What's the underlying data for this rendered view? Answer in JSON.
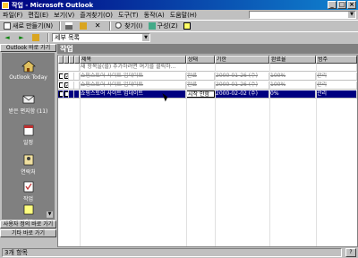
{
  "window": {
    "title": "작업 - Microsoft Outlook"
  },
  "menu": [
    "파일(F)",
    "편집(E)",
    "보기(V)",
    "즐겨찾기(O)",
    "도구(T)",
    "동작(A)",
    "도움말(H)"
  ],
  "toolbar": {
    "new_label": "새로 만들기(N)",
    "find_label": "찾기(I)",
    "organize_label": "구성(Z)",
    "view_value": "세부 목록"
  },
  "outlook_bar": {
    "header": "Outlook 바로 가기",
    "items": [
      {
        "label": "Outlook Today",
        "icon": "house-icon"
      },
      {
        "label": "받은 편지함 (11)",
        "icon": "inbox-icon"
      },
      {
        "label": "일정",
        "icon": "calendar-icon"
      },
      {
        "label": "연락처",
        "icon": "contacts-icon"
      },
      {
        "label": "작업",
        "icon": "tasks-icon"
      },
      {
        "label": "메모",
        "icon": "notes-icon"
      }
    ],
    "groups": [
      "사용자 정의 바로 가기",
      "기타 바로 가기"
    ]
  },
  "folder": {
    "title": "작업"
  },
  "grid": {
    "columns": [
      "",
      "",
      "",
      "",
      "제목",
      "상태",
      "기한",
      "완료율",
      "범주"
    ],
    "new_row_hint": "새 항목을(를) 추가하려면 여기를 클릭하...",
    "rows": [
      {
        "subject": "쇼핑스토어 사이트 업데이트",
        "status": "완료",
        "due": "2000-01-26 (수)",
        "pct": "100%",
        "category": "관리",
        "state": "done"
      },
      {
        "subject": "쇼핑스토어 사이트 업데이트",
        "status": "완료",
        "due": "2000-01-26 (수)",
        "pct": "100%",
        "category": "관리",
        "state": "done"
      },
      {
        "subject": "쇼핑스토어 사이트 업데이트",
        "status": "시작 안함",
        "due": "2000-02-02 (수)",
        "pct": "0%",
        "category": "관리",
        "state": "selected"
      }
    ]
  },
  "status": {
    "text": "3개 항목"
  }
}
